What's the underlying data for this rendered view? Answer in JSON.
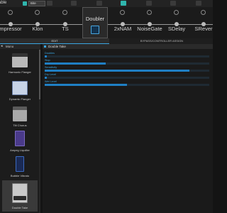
{
  "toolbar": {
    "preset_left": "able",
    "preset_name": "Bite"
  },
  "chain": {
    "nodes": [
      {
        "label": "mpressor"
      },
      {
        "label": "Klon"
      },
      {
        "label": "TS"
      },
      {
        "label": "Doubler"
      },
      {
        "label": "2xNAM"
      },
      {
        "label": "NoiseGate"
      },
      {
        "label": "SDelay"
      },
      {
        "label": "SRever"
      }
    ],
    "selected": "Doubler"
  },
  "tabs": {
    "edit": "EDIT",
    "bypass": "BYPASS/CONTROLLER ASSIGN"
  },
  "sidebar": {
    "header": "Mono",
    "back_icon": "arrow-left-icon",
    "items": [
      {
        "name": "Harmonic Flanger"
      },
      {
        "name": "Dynamic Flanger"
      },
      {
        "name": "Tilt Chorus"
      },
      {
        "name": "Ampeg Liquifier"
      },
      {
        "name": "Bubble Vibrato"
      },
      {
        "name": "Double Take"
      }
    ],
    "selected_index": 5
  },
  "main": {
    "title": "Double Take",
    "params": [
      {
        "label": "Doubles",
        "value": 0.0
      },
      {
        "label": "Slop",
        "value": 0.37
      },
      {
        "label": "Sensitivity",
        "value": 0.88
      },
      {
        "label": "Dry Level",
        "value": 0.0
      },
      {
        "label": "Wet Level",
        "value": 0.5
      }
    ]
  },
  "colors": {
    "accent": "#3aa5e0",
    "slider_fill": "#1f7fc4",
    "background": "#141414"
  }
}
